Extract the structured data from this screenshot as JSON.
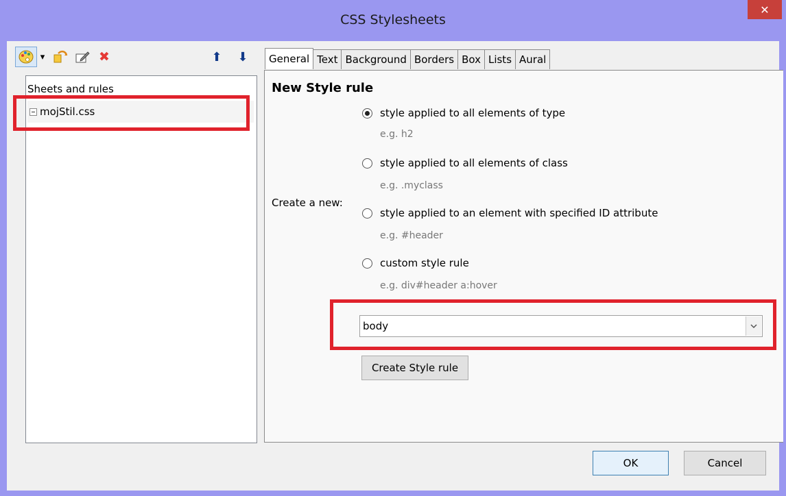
{
  "window": {
    "title": "CSS Stylesheets",
    "close_glyph": "✕"
  },
  "toolbar": {
    "icons": [
      "palette-icon",
      "dropdown-arrow-icon",
      "new-sheet-icon",
      "edit-icon",
      "delete-icon",
      "move-up-icon",
      "move-down-icon"
    ],
    "dropdown_glyph": "▾",
    "up_glyph": "⬆",
    "down_glyph": "⬇",
    "delete_glyph": "✖"
  },
  "left_panel": {
    "header": "Sheets and rules",
    "items": [
      {
        "label": "mojStil.css"
      }
    ]
  },
  "tabs": [
    {
      "label": "General"
    },
    {
      "label": "Text"
    },
    {
      "label": "Background"
    },
    {
      "label": "Borders"
    },
    {
      "label": "Box"
    },
    {
      "label": "Lists"
    },
    {
      "label": "Aural"
    }
  ],
  "general": {
    "heading": "New Style rule",
    "create_label": "Create a new:",
    "options": [
      {
        "label": "style applied to all elements of type",
        "example": "e.g. h2",
        "checked": true
      },
      {
        "label": "style applied to all elements of class",
        "example": "e.g. .myclass",
        "checked": false
      },
      {
        "label": "style applied to an element with specified ID attribute",
        "example": "e.g. #header",
        "checked": false
      },
      {
        "label": "custom style rule",
        "example": "e.g. div#header a:hover",
        "checked": false
      }
    ],
    "selector_value": "body",
    "combo_arrow_glyph": "⌄",
    "create_button": "Create Style rule"
  },
  "buttons": {
    "ok": "OK",
    "cancel": "Cancel"
  },
  "colors": {
    "window_frame": "#9a97f0",
    "close_button": "#c7403a",
    "highlight": "#e0222c"
  }
}
